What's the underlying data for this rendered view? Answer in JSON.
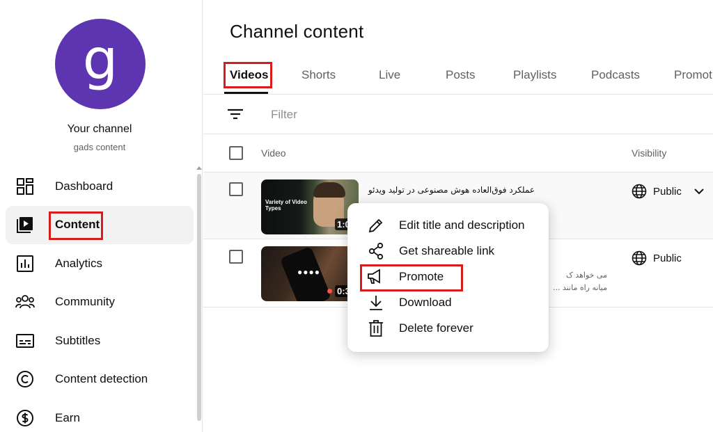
{
  "sidebar": {
    "avatar_letter": "g",
    "avatar_color": "#5e35b1",
    "channel_title": "Your channel",
    "channel_subtitle": "gads content",
    "items": [
      {
        "label": "Dashboard",
        "icon": "dashboard-icon"
      },
      {
        "label": "Content",
        "icon": "content-icon",
        "active": true
      },
      {
        "label": "Analytics",
        "icon": "analytics-icon"
      },
      {
        "label": "Community",
        "icon": "community-icon"
      },
      {
        "label": "Subtitles",
        "icon": "subtitles-icon"
      },
      {
        "label": "Content detection",
        "icon": "copyright-icon"
      },
      {
        "label": "Earn",
        "icon": "dollar-icon"
      }
    ]
  },
  "main": {
    "title": "Channel content",
    "tabs": [
      "Videos",
      "Shorts",
      "Live",
      "Posts",
      "Playlists",
      "Podcasts",
      "Promot"
    ],
    "active_tab": "Videos",
    "filter_placeholder": "Filter",
    "columns": {
      "video": "Video",
      "visibility": "Visibility"
    },
    "rows": [
      {
        "title": "عملکرد فوق‌العاده هوش مصنوعی در تولید ویدئو",
        "thumb_text": "Variety of Video Types",
        "duration": "1:09",
        "visibility": "Public"
      },
      {
        "desc_line1": "می خواهد ک",
        "desc_line2": "میانه راه مانند ...",
        "duration": "0:37",
        "visibility": "Public"
      }
    ]
  },
  "menu": {
    "items": [
      {
        "label": "Edit title and description",
        "icon": "pencil-icon"
      },
      {
        "label": "Get shareable link",
        "icon": "share-icon"
      },
      {
        "label": "Promote",
        "icon": "megaphone-icon"
      },
      {
        "label": "Download",
        "icon": "download-icon"
      },
      {
        "label": "Delete forever",
        "icon": "trash-icon"
      }
    ]
  },
  "colors": {
    "highlight": "#d81c1c",
    "accent": "#0f0f0f"
  }
}
